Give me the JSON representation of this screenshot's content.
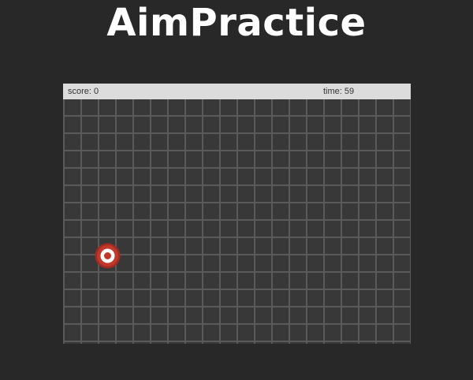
{
  "header": {
    "title": "AimPractice"
  },
  "hud": {
    "score": "score: 0",
    "time": "time: 59"
  },
  "target": {
    "icon": "bullseye-target-icon",
    "outer_color": "#c0392b",
    "inner_color": "#ffffff"
  },
  "colors": {
    "background": "#282828",
    "board": "#383838",
    "grid_lines": "#5a5a5a",
    "hud_bar": "#dcdcdc"
  }
}
